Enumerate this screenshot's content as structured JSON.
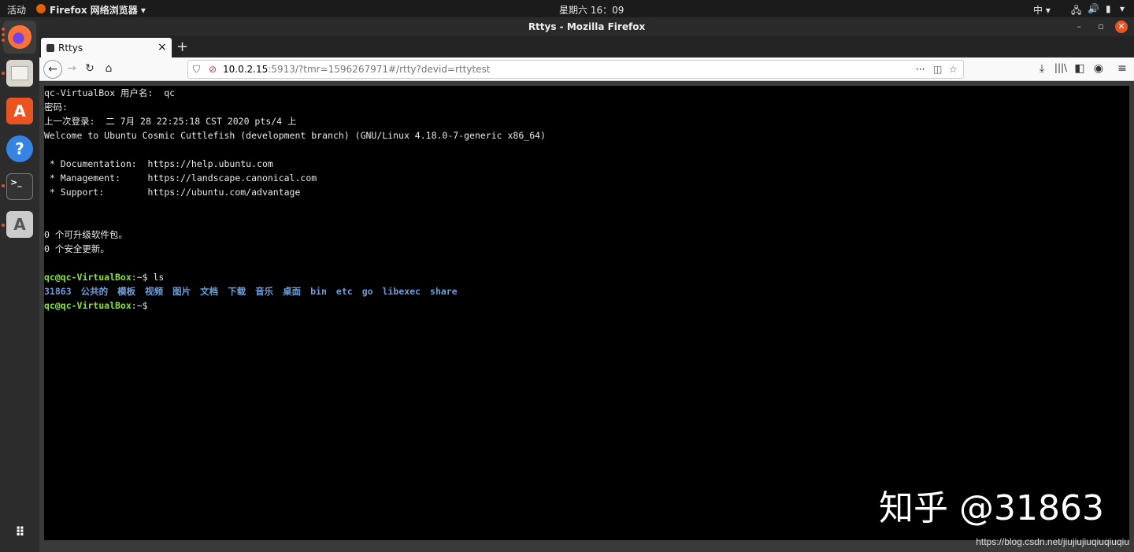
{
  "topbar": {
    "activities": "活动",
    "app_menu": "Firefox 网络浏览器 ▾",
    "clock": "星期六 16：09",
    "input_method": "中 ▾",
    "system_menu": "▾"
  },
  "window": {
    "title": "Rttys - Mozilla Firefox"
  },
  "tab": {
    "label": "Rttys",
    "close": "×",
    "new_tab": "+"
  },
  "url": {
    "host": "10.0.2.15",
    "rest": ":5913/?tmr=1596267971#/rtty?devid=rttytest"
  },
  "terminal": {
    "lines": [
      "qc-VirtualBox 用户名:  qc",
      "密码:",
      "上一次登录:  二 7月 28 22:25:18 CST 2020 pts/4 上",
      "Welcome to Ubuntu Cosmic Cuttlefish (development branch) (GNU/Linux 4.18.0-7-generic x86_64)",
      "",
      " * Documentation:  https://help.ubuntu.com",
      " * Management:     https://landscape.canonical.com",
      " * Support:        https://ubuntu.com/advantage",
      "",
      "",
      "0 个可升级软件包。",
      "0 个安全更新。",
      ""
    ],
    "prompt": "qc@qc-VirtualBox",
    "prompt_suffix": ":~$ ",
    "command": "ls",
    "ls_output": [
      "31863",
      "公共的",
      "模板",
      "视频",
      "图片",
      "文档",
      "下载",
      "音乐",
      "桌面",
      "bin",
      "etc",
      "go",
      "libexec",
      "share"
    ]
  },
  "watermark": {
    "zhihu": "知乎 @31863",
    "csdn": "https://blog.csdn.net/jiujiujiuqiuqiuqiu"
  }
}
